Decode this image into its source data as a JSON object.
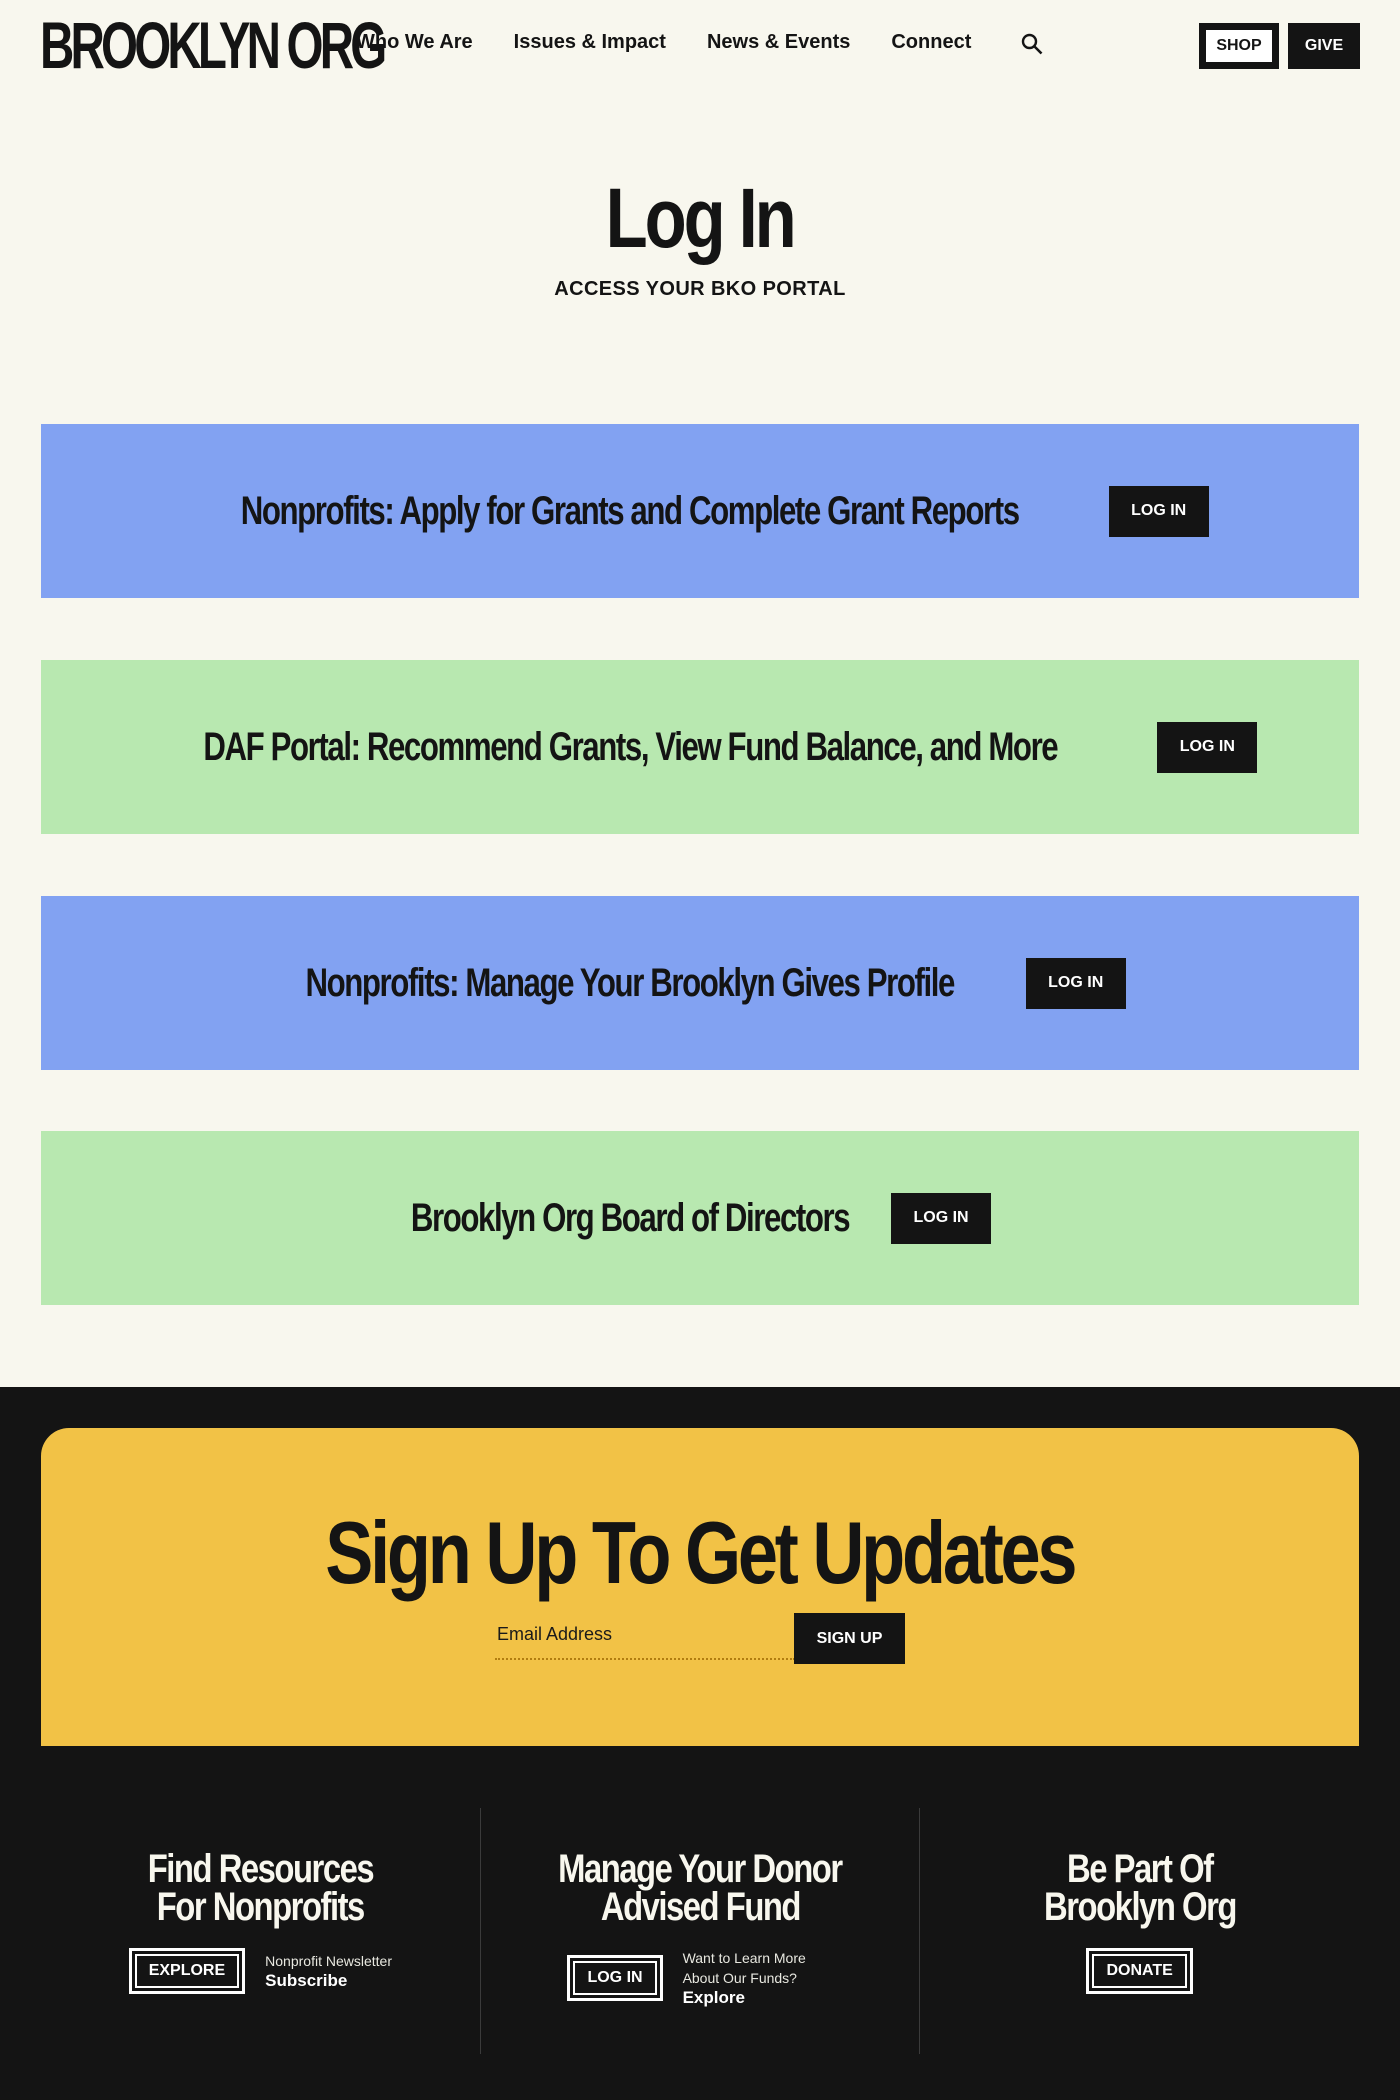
{
  "header": {
    "logo": "BROOKLYN ORG",
    "nav": [
      "Who We Are",
      "Issues & Impact",
      "News & Events",
      "Connect"
    ],
    "search_icon": "search-icon",
    "shop_label": "SHOP",
    "give_label": "GIVE"
  },
  "main": {
    "title": "Log In",
    "subtitle": "ACCESS YOUR BKO PORTAL",
    "portals": [
      {
        "title": "Nonprofits: Apply for Grants and Complete Grant Reports",
        "button": "LOG IN",
        "color": "#82a2f2"
      },
      {
        "title": "DAF Portal: Recommend Grants, View Fund Balance, and More",
        "button": "LOG IN",
        "color": "#b8e8b0"
      },
      {
        "title": "Nonprofits: Manage Your Brooklyn Gives Profile",
        "button": "LOG IN",
        "color": "#82a2f2"
      },
      {
        "title": "Brooklyn Org Board of Directors",
        "button": "LOG IN",
        "color": "#b8e8b0"
      }
    ]
  },
  "signup": {
    "title": "Sign Up To Get Updates",
    "email_placeholder": "Email Address",
    "button": "SIGN UP",
    "color": "#f2c246"
  },
  "footer": {
    "columns": [
      {
        "title_line1": "Find Resources",
        "title_line2": "For Nonprofits",
        "button": "EXPLORE",
        "side_text": "Nonprofit Newsletter",
        "side_link": "Subscribe"
      },
      {
        "title_line1": "Manage Your Donor",
        "title_line2": "Advised Fund",
        "button": "LOG IN",
        "side_text": "Want to Learn More About Our Funds?",
        "side_link": "Explore"
      },
      {
        "title_line1": "Be Part Of",
        "title_line2": "Brooklyn Org",
        "button": "DONATE"
      }
    ]
  }
}
